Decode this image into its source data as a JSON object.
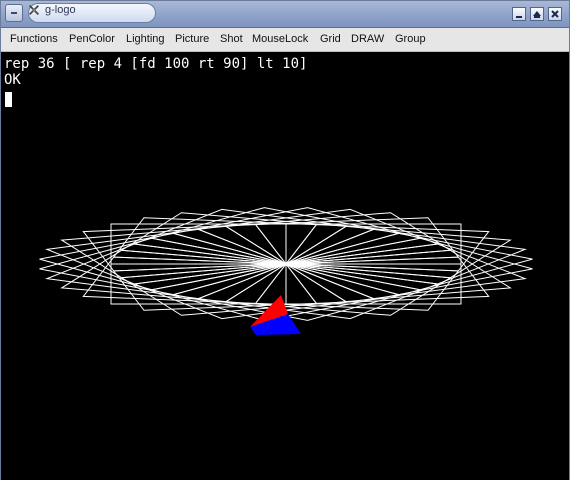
{
  "window": {
    "title": "g-logo"
  },
  "menu": {
    "items": [
      "Functions",
      "PenColor",
      "Lighting",
      "Picture",
      "Shot",
      "MouseLock",
      "Grid",
      "DRAW",
      "Group"
    ]
  },
  "console": {
    "command": "rep 36 [ rep 4 [fd 100 rt 90] lt 10]",
    "response": "OK"
  },
  "drawing": {
    "pen_color": "#ffffff",
    "turtle_colors": [
      "#ff0000",
      "#0000ff"
    ],
    "repeat_outer": 36,
    "repeat_inner": 4,
    "forward": 100,
    "right_turn": 90,
    "left_turn": 10
  }
}
